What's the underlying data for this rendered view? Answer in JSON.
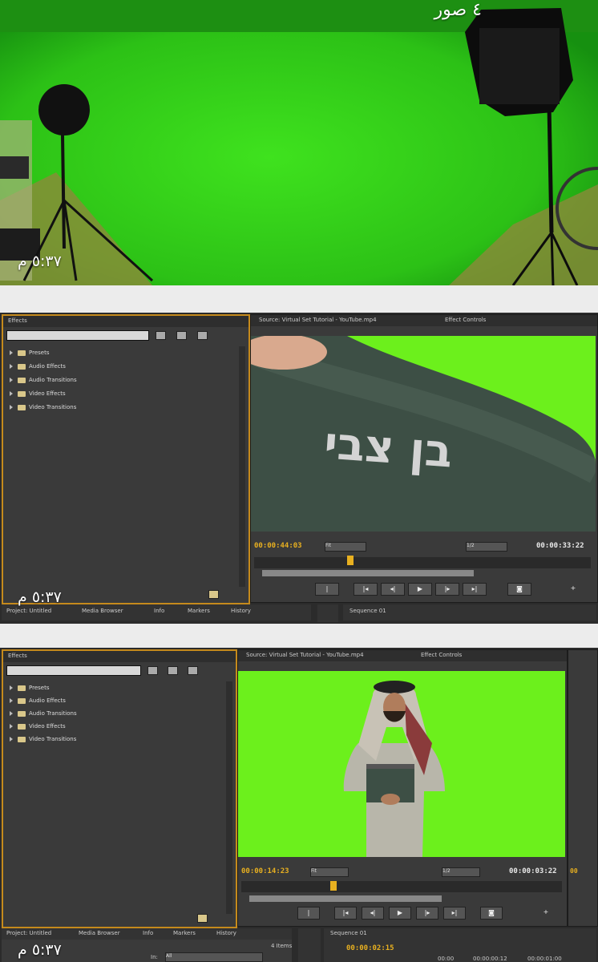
{
  "header": {
    "photo_count": "٤ صور"
  },
  "messages": [
    {
      "time": "٥:٣٧ م"
    },
    {
      "time": "٥:٣٧ م"
    },
    {
      "time": "٥:٣٧ م"
    }
  ],
  "premiere": {
    "effects_tab": "Effects",
    "source_tab": "Source: Virtual Set Tutorial - YouTube.mp4",
    "effect_controls_tab": "Effect Controls",
    "tree": [
      "Presets",
      "Audio Effects",
      "Audio Transitions",
      "Video Effects",
      "Video Transitions"
    ],
    "bottom_tabs": [
      "Project: Untitled",
      "Media Browser",
      "Info",
      "Markers",
      "History"
    ],
    "sequence_tab": "Sequence 01",
    "fit_label": "Fit",
    "ratio_label": "1/2",
    "shot2": {
      "timecode_in": "00:00:44:03",
      "timecode_dur": "00:00:33:22"
    },
    "shot3": {
      "timecode_in": "00:00:14:23",
      "timecode_dur": "00:00:03:22",
      "seq_tc": "00:00:02:15",
      "ruler": [
        "00:00",
        "00:00:00:12",
        "00:00:01:00"
      ],
      "in_label": "In:",
      "in_value": "All",
      "items_label": "4 Items"
    },
    "bag_text": "בן צבי"
  }
}
